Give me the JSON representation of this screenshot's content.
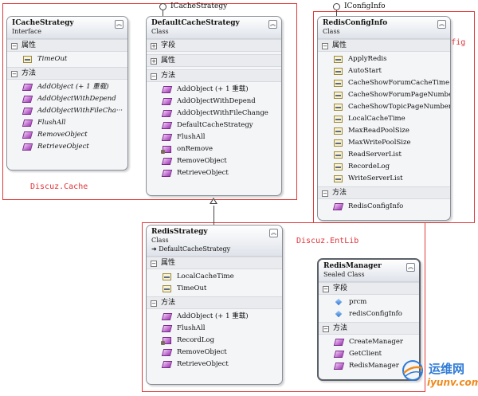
{
  "interfaces": {
    "icache": "ICacheStrategy",
    "iconfig": "IConfigInfo"
  },
  "labels": {
    "cache": "Discuz.Cache",
    "config": "Discuz.Config",
    "entlib": "Discuz.EntLib"
  },
  "icachestrategy": {
    "title": "ICacheStrategy",
    "kind": "Interface",
    "sections": {
      "props": "属性",
      "methods": "方法"
    },
    "props": [
      "TimeOut"
    ],
    "methods": [
      "AddObject (+ 1 重载)",
      "AddObjectWithDepend",
      "AddObjectWithFileCha···",
      "FlushAll",
      "RemoveObject",
      "RetrieveObject"
    ]
  },
  "defaultcache": {
    "title": "DefaultCacheStrategy",
    "kind": "Class",
    "sections": {
      "fields": "字段",
      "props": "属性",
      "methods": "方法"
    },
    "methods": [
      "AddObject (+ 1 重载)",
      "AddObjectWithDepend",
      "AddObjectWithFileChange",
      "DefaultCacheStrategy",
      "FlushAll",
      "onRemove",
      "RemoveObject",
      "RetrieveObject"
    ]
  },
  "redisconfig": {
    "title": "RedisConfigInfo",
    "kind": "Class",
    "sections": {
      "props": "属性",
      "methods": "方法"
    },
    "props": [
      "ApplyRedis",
      "AutoStart",
      "CacheShowForumCacheTime",
      "CacheShowForumPageNumber",
      "CacheShowTopicPageNumber",
      "LocalCacheTime",
      "MaxReadPoolSize",
      "MaxWritePoolSize",
      "ReadServerList",
      "RecordeLog",
      "WriteServerList"
    ],
    "methods": [
      "RedisConfigInfo"
    ]
  },
  "redisstrategy": {
    "title": "RedisStrategy",
    "kind": "Class",
    "inherits": "DefaultCacheStrategy",
    "sections": {
      "props": "属性",
      "methods": "方法"
    },
    "props": [
      "LocalCacheTime",
      "TimeOut"
    ],
    "methods": [
      "AddObject (+ 1 重载)",
      "FlushAll",
      "RecordLog",
      "RemoveObject",
      "RetrieveObject"
    ]
  },
  "redismanager": {
    "title": "RedisManager",
    "kind": "Sealed Class",
    "sections": {
      "fields": "字段",
      "methods": "方法"
    },
    "fields": [
      "prcm",
      "redisConfigInfo"
    ],
    "methods": [
      "CreateManager",
      "GetClient",
      "RedisManager"
    ]
  },
  "watermark": {
    "cn": "运维网",
    "url": "iyunv.com"
  },
  "colors": {
    "red": "#e23b3b",
    "wmblue": "#2f7bd6",
    "wmorange": "#f08a1c"
  }
}
